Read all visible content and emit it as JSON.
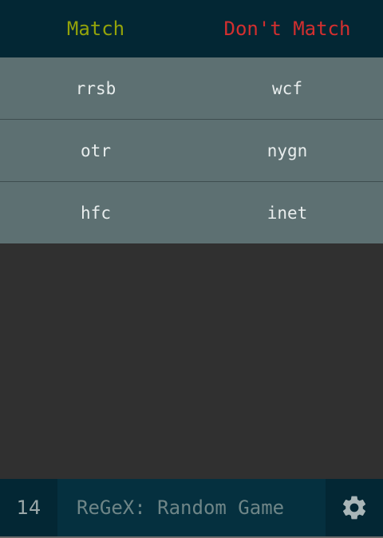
{
  "header": {
    "match_label": "Match",
    "dont_match_label": "Don't Match"
  },
  "rows": [
    {
      "match": "rrsb",
      "dont_match": "wcf"
    },
    {
      "match": "otr",
      "dont_match": "nygn"
    },
    {
      "match": "hfc",
      "dont_match": "inet"
    }
  ],
  "footer": {
    "score": "14",
    "regex_placeholder": "ReGeX: Random Game",
    "regex_value": "",
    "settings_icon": "gear-icon"
  },
  "colors": {
    "header_bg": "#032734",
    "match": "#93a30a",
    "dont_match": "#d32f2f",
    "row_bg": "#5d7072",
    "body_bg": "#303030"
  }
}
